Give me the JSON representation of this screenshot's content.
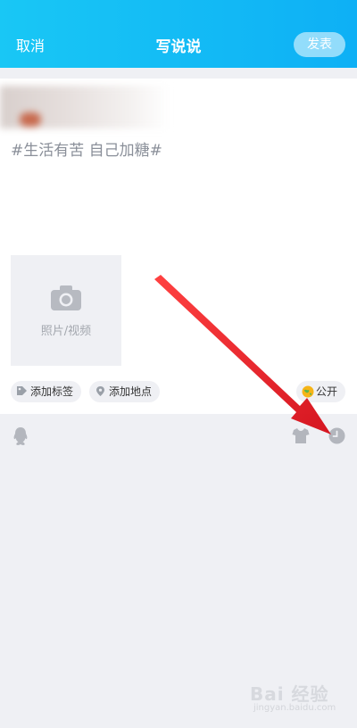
{
  "header": {
    "cancel_label": "取消",
    "title": "写说说",
    "publish_label": "发表"
  },
  "post": {
    "text": "#生活有苦 自己加糖#"
  },
  "media": {
    "label": "照片/视频",
    "icon": "camera-icon"
  },
  "chips": {
    "add_tag": "添加标签",
    "add_location": "添加地点",
    "visibility": "公开"
  },
  "toolbar": {
    "icons": [
      "qq-icon",
      "shirt-icon",
      "clock-icon"
    ]
  },
  "watermark": {
    "brand": "Bai 经验",
    "url": "jingyan.baidu.com"
  },
  "colors": {
    "header_gradient_start": "#19c7f5",
    "header_gradient_end": "#0eb0f5",
    "arrow": "#e8202a",
    "background": "#eff0f4"
  }
}
